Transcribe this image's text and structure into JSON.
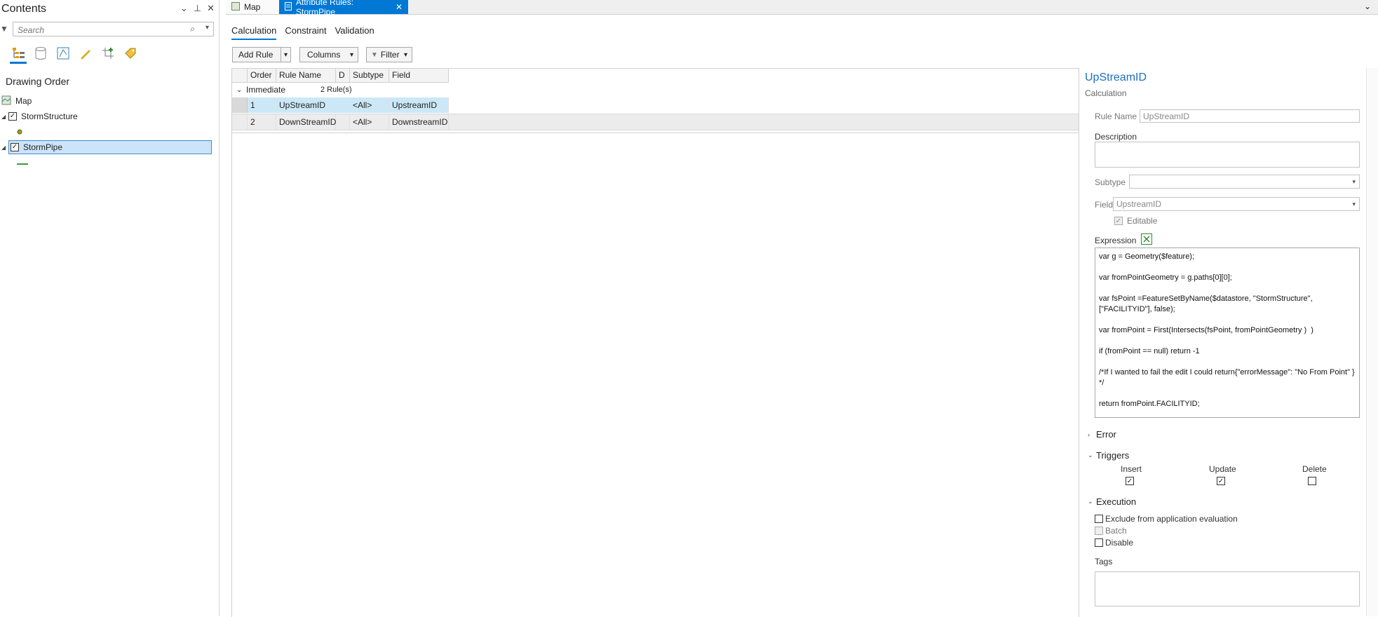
{
  "contents": {
    "title": "Contents",
    "search_placeholder": "Search",
    "drawing_order_title": "Drawing Order",
    "tree": {
      "map_label": "Map",
      "layers": [
        {
          "name": "StormStructure",
          "checked": "✓"
        },
        {
          "name": "StormPipe",
          "checked": "✓"
        }
      ]
    }
  },
  "tabs": {
    "map_tab": "Map",
    "rules_tab": "Attribute Rules: StormPipe"
  },
  "sub_tabs": [
    "Calculation",
    "Constraint",
    "Validation"
  ],
  "toolbar": {
    "add_rule": "Add Rule",
    "columns": "Columns",
    "filter": "Filter"
  },
  "grid": {
    "headers": [
      "Order",
      "Rule Name",
      "D",
      "Subtype",
      "Field"
    ],
    "group": {
      "name": "Immediate",
      "count": "2 Rule(s)"
    },
    "rows": [
      {
        "order": "1",
        "rule_name": "UpStreamID",
        "d": "",
        "subtype": "<All>",
        "field": "UpstreamID"
      },
      {
        "order": "2",
        "rule_name": "DownStreamID",
        "d": "",
        "subtype": "<All>",
        "field": "DownstreamID"
      }
    ]
  },
  "details": {
    "title": "UpStreamID",
    "subtitle": "Calculation",
    "rule_name_label": "Rule Name",
    "rule_name_value": "UpStreamID",
    "description_label": "Description",
    "subtype_label": "Subtype",
    "field_label": "Field",
    "field_value": "UpstreamID",
    "editable_label": "Editable",
    "expression_label": "Expression",
    "expression": "var g = Geometry($feature);\n\nvar fromPointGeometry = g.paths[0][0];\n\nvar fsPoint =FeatureSetByName($datastore, \"StormStructure\", [\"FACILITYID\"], false);\n\nvar fromPoint = First(Intersects(fsPoint, fromPointGeometry )  )\n\nif (fromPoint == null) return -1\n\n/*If I wanted to fail the edit I could return{\"errorMessage\": \"No From Point\" }\n*/\n\nreturn fromPoint.FACILITYID;",
    "error_section": "Error",
    "triggers_section": "Triggers",
    "triggers": {
      "insert": "Insert",
      "update": "Update",
      "delete": "Delete"
    },
    "execution_section": "Execution",
    "exclude_label": "Exclude from application evaluation",
    "batch_label": "Batch",
    "disable_label": "Disable",
    "tags_label": "Tags"
  }
}
